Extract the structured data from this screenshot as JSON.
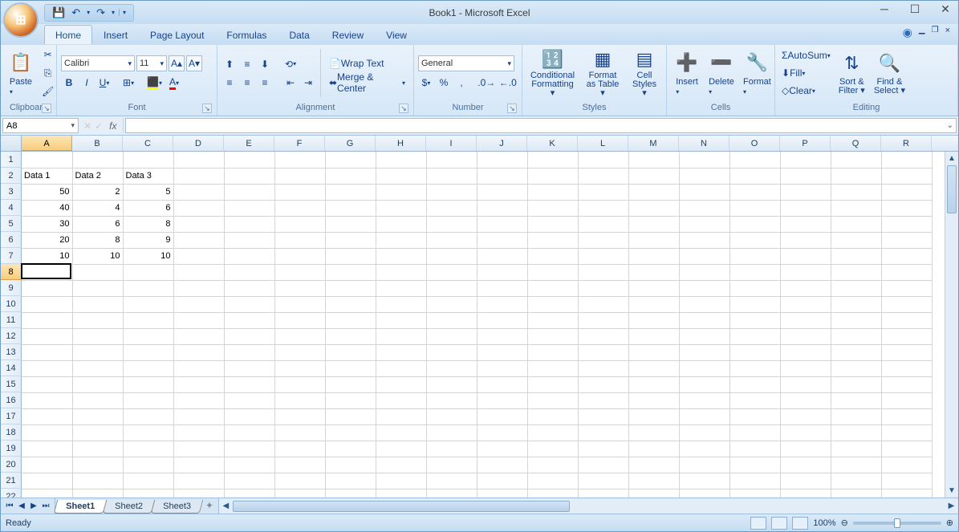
{
  "title": "Book1 - Microsoft Excel",
  "qat": {
    "save": "💾",
    "undo": "↶",
    "redo": "↷"
  },
  "tabs": [
    "Home",
    "Insert",
    "Page Layout",
    "Formulas",
    "Data",
    "Review",
    "View"
  ],
  "active_tab": "Home",
  "ribbon": {
    "clipboard": {
      "paste": "Paste",
      "label": "Clipboard"
    },
    "font": {
      "name": "Calibri",
      "size": "11",
      "label": "Font"
    },
    "alignment": {
      "wrap": "Wrap Text",
      "merge": "Merge & Center",
      "label": "Alignment"
    },
    "number": {
      "format": "General",
      "label": "Number"
    },
    "styles": {
      "cond": "Conditional\nFormatting",
      "table": "Format\nas Table",
      "cell": "Cell\nStyles",
      "label": "Styles"
    },
    "cells": {
      "insert": "Insert",
      "delete": "Delete",
      "format": "Format",
      "label": "Cells"
    },
    "editing": {
      "sum": "AutoSum",
      "fill": "Fill",
      "clear": "Clear",
      "sort": "Sort &\nFilter",
      "find": "Find &\nSelect",
      "label": "Editing"
    }
  },
  "namebox": "A8",
  "columns": [
    "A",
    "B",
    "C",
    "D",
    "E",
    "F",
    "G",
    "H",
    "I",
    "J",
    "K",
    "L",
    "M",
    "N",
    "O",
    "P",
    "Q",
    "R"
  ],
  "rows": [
    1,
    2,
    3,
    4,
    5,
    6,
    7,
    8,
    9,
    10,
    11,
    12,
    13,
    14,
    15,
    16,
    17,
    18,
    19,
    20,
    21,
    22
  ],
  "selected_col": "A",
  "selected_row": 8,
  "data": {
    "2": {
      "A": "Data 1",
      "B": "Data 2",
      "C": "Data 3"
    },
    "3": {
      "A": "50",
      "B": "2",
      "C": "5"
    },
    "4": {
      "A": "40",
      "B": "4",
      "C": "6"
    },
    "5": {
      "A": "30",
      "B": "6",
      "C": "8"
    },
    "6": {
      "A": "20",
      "B": "8",
      "C": "9"
    },
    "7": {
      "A": "10",
      "B": "10",
      "C": "10"
    }
  },
  "sheets": [
    "Sheet1",
    "Sheet2",
    "Sheet3"
  ],
  "active_sheet": "Sheet1",
  "status": "Ready",
  "zoom": "100%",
  "chart_data": {
    "type": "table",
    "columns": [
      "Data 1",
      "Data 2",
      "Data 3"
    ],
    "rows": [
      [
        50,
        2,
        5
      ],
      [
        40,
        4,
        6
      ],
      [
        30,
        6,
        8
      ],
      [
        20,
        8,
        9
      ],
      [
        10,
        10,
        10
      ]
    ]
  }
}
